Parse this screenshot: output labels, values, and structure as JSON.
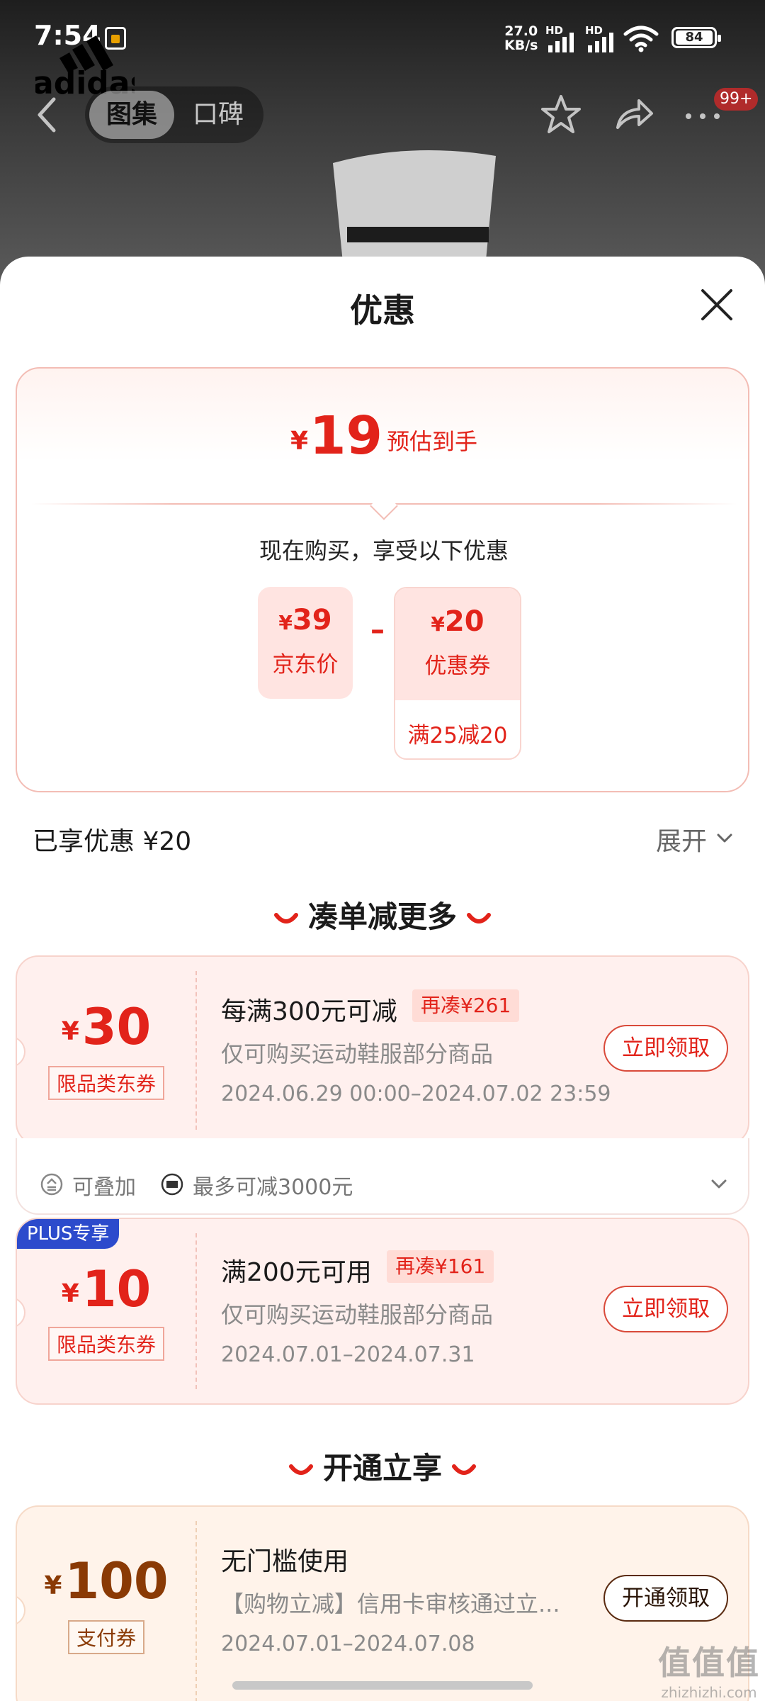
{
  "status_bar": {
    "time": "7:54",
    "net_speed_value": "27.0",
    "net_speed_unit": "KB/s",
    "signal1_label": "HD",
    "signal2_label": "HD",
    "battery": "84"
  },
  "header": {
    "brand_logo_text": "adidas",
    "tabs": [
      {
        "label": "图集",
        "active": true
      },
      {
        "label": "口碑",
        "active": false
      }
    ],
    "more_badge": "99+"
  },
  "sheet": {
    "title": "优惠",
    "summary": {
      "currency": "¥",
      "estimated_price": "19",
      "estimated_label": "预估到手",
      "buy_now_text": "现在购买，享受以下优惠",
      "jd_price_value": "39",
      "jd_price_label": "京东价",
      "minus_sign": "–",
      "coupon_value": "20",
      "coupon_label": "优惠券",
      "coupon_condition": "满25减20"
    },
    "enjoyed_text": "已享优惠 ¥20",
    "expand_label": "展开",
    "section1_title": "凑单减更多",
    "coupons": [
      {
        "currency": "¥",
        "value": "30",
        "type": "限品类东券",
        "title": "每满300元可减",
        "tag": "再凑¥261",
        "desc": "仅可购买运动鞋服部分商品",
        "date": "2024.06.29 00:00–2024.07.02 23:59",
        "button": "立即领取",
        "footer": {
          "stackable": "可叠加",
          "max_discount": "最多可减3000元"
        }
      },
      {
        "badge": "PLUS专享",
        "currency": "¥",
        "value": "10",
        "type": "限品类东券",
        "title": "满200元可用",
        "tag": "再凑¥161",
        "desc": "仅可购买运动鞋服部分商品",
        "date": "2024.07.01–2024.07.31",
        "button": "立即领取"
      }
    ],
    "section2_title": "开通立享",
    "pay_coupon": {
      "currency": "¥",
      "value": "100",
      "type": "支付券",
      "title": "无门槛使用",
      "desc": "【购物立减】信用卡审核通过立...",
      "date": "2024.07.01–2024.07.08",
      "button": "开通领取"
    }
  },
  "watermark": {
    "main": "值值值",
    "site": "zhizhizhi.com"
  },
  "colors": {
    "accent_red": "#e2231a",
    "gold_text": "#8a3a05",
    "plus_blue": "#2c4bcc"
  }
}
